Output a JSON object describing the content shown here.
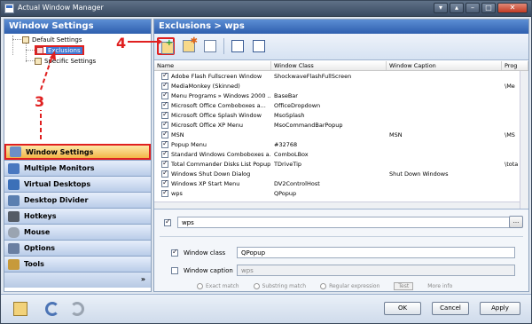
{
  "app": {
    "title": "Actual Window Manager",
    "colors": {
      "accent": "#3f78d2",
      "annotation": "#e02020"
    }
  },
  "left_panel": {
    "header": "Window Settings",
    "tree": [
      {
        "label": "Default Settings",
        "selected": false
      },
      {
        "label": "Exclusions",
        "selected": true
      },
      {
        "label": "Specific Settings",
        "selected": false
      }
    ],
    "nav": [
      {
        "label": "Window Settings",
        "icon": "window-settings-icon",
        "active": true
      },
      {
        "label": "Multiple Monitors",
        "icon": "monitors-icon"
      },
      {
        "label": "Virtual Desktops",
        "icon": "desktops-icon"
      },
      {
        "label": "Desktop Divider",
        "icon": "divider-icon"
      },
      {
        "label": "Hotkeys",
        "icon": "keyboard-icon"
      },
      {
        "label": "Mouse",
        "icon": "mouse-icon"
      },
      {
        "label": "Options",
        "icon": "options-icon"
      },
      {
        "label": "Tools",
        "icon": "tools-icon"
      }
    ],
    "more_glyph": "»"
  },
  "right_panel": {
    "header": "Exclusions > wps",
    "list": {
      "columns": [
        "Name",
        "Window Class",
        "Window Caption",
        "Prog"
      ],
      "rows": [
        {
          "name": "Adobe Flash Fullscreen Window",
          "class": "ShockwaveFlashFullScreen",
          "caption": "",
          "prog": ""
        },
        {
          "name": "MediaMonkey (Skinned)",
          "class": "",
          "caption": "",
          "prog": "\\Me"
        },
        {
          "name": "Menu Programs » Windows 2000 ...",
          "class": "BaseBar",
          "caption": "",
          "prog": ""
        },
        {
          "name": "Microsoft Office Comboboxes a...",
          "class": "OfficeDropdown",
          "caption": "",
          "prog": ""
        },
        {
          "name": "Microsoft Office Splash Window",
          "class": "MsoSplash",
          "caption": "",
          "prog": ""
        },
        {
          "name": "Microsoft Office XP Menu",
          "class": "MsoCommandBarPopup",
          "caption": "",
          "prog": ""
        },
        {
          "name": "MSN",
          "class": "",
          "caption": "MSN",
          "prog": "\\MS"
        },
        {
          "name": "Popup Menu",
          "class": "#32768",
          "caption": "",
          "prog": ""
        },
        {
          "name": "Standard Windows Comboboxes a...",
          "class": "ComboLBox",
          "caption": "",
          "prog": ""
        },
        {
          "name": "Total Commander Disks List Popup",
          "class": "TDriveTip",
          "caption": "",
          "prog": "\\tota"
        },
        {
          "name": "Windows Shut Down Dialog",
          "class": "",
          "caption": "Shut Down Windows",
          "prog": ""
        },
        {
          "name": "Windows XP Start Menu",
          "class": "DV2ControlHost",
          "caption": "",
          "prog": ""
        },
        {
          "name": "wps",
          "class": "QPopup",
          "caption": "",
          "prog": ""
        }
      ]
    },
    "editor": {
      "pattern_value": "wps",
      "browse_label": "...",
      "window_class_label": "Window class",
      "window_class_value": "QPopup",
      "window_caption_label": "Window caption",
      "window_caption_value": "wps",
      "match_options": [
        "Exact match",
        "Substring match",
        "Regular expression"
      ],
      "test_label": "Test",
      "more_info": "More info"
    }
  },
  "buttons": {
    "ok": "OK",
    "cancel": "Cancel",
    "apply": "Apply"
  },
  "annotations": {
    "step3": "3",
    "step4": "4"
  }
}
